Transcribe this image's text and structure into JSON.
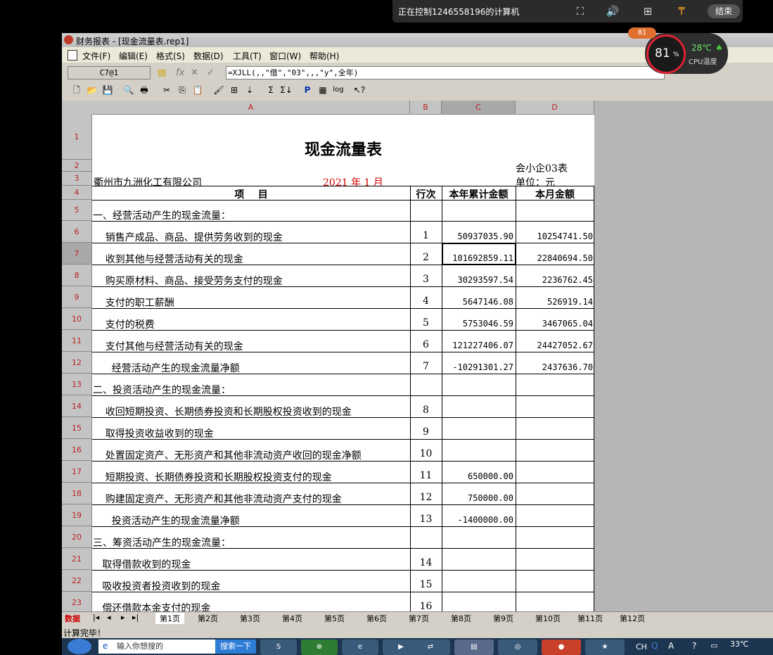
{
  "remote": {
    "title": "正在控制1246558196的计算机",
    "end_label": "结束"
  },
  "window": {
    "title": "财务报表 - [现金流量表.rep1]"
  },
  "menu": [
    "文件(F)",
    "编辑(E)",
    "格式(S)",
    "数据(D)",
    "工具(T)",
    "窗口(W)",
    "帮助(H)"
  ],
  "formula_bar": {
    "cell_ref": "C7@1",
    "formula": "=XJLL(,,\"借\",\"03\",,,\"y\",全年)"
  },
  "columns": [
    "A",
    "B",
    "C",
    "D"
  ],
  "report": {
    "title": "现金流量表",
    "form_no": "会小企03表",
    "company": "衢州市九洲化工有限公司",
    "period": "2021 年  1 月",
    "unit": "单位：元",
    "headers": [
      "项    目",
      "行次",
      "本年累计金额",
      "本月金额"
    ]
  },
  "rows": [
    {
      "row": "5",
      "item": "一、经营活动产生的现金流量：",
      "line": "",
      "ytd": "",
      "month": ""
    },
    {
      "row": "6",
      "item": "    销售产成品、商品、提供劳务收到的现金",
      "line": "1",
      "ytd": "50937035.90",
      "month": "10254741.50"
    },
    {
      "row": "7",
      "item": "    收到其他与经营活动有关的现金",
      "line": "2",
      "ytd": "101692859.11",
      "month": "22840694.50"
    },
    {
      "row": "8",
      "item": "    购买原材料、商品、接受劳务支付的现金",
      "line": "3",
      "ytd": "30293597.54",
      "month": "2236762.45"
    },
    {
      "row": "9",
      "item": "    支付的职工薪酬",
      "line": "4",
      "ytd": "5647146.08",
      "month": "526919.14"
    },
    {
      "row": "10",
      "item": "    支付的税费",
      "line": "5",
      "ytd": "5753046.59",
      "month": "3467065.04"
    },
    {
      "row": "11",
      "item": "    支付其他与经营活动有关的现金",
      "line": "6",
      "ytd": "121227406.07",
      "month": "24427052.67"
    },
    {
      "row": "12",
      "item": "      经营活动产生的现金流量净额",
      "line": "7",
      "ytd": "-10291301.27",
      "month": "2437636.70"
    },
    {
      "row": "13",
      "item": "二、投资活动产生的现金流量：",
      "line": "",
      "ytd": "",
      "month": ""
    },
    {
      "row": "14",
      "item": "    收回短期投资、长期债券投资和长期股权投资收到的现金",
      "line": "8",
      "ytd": "",
      "month": ""
    },
    {
      "row": "15",
      "item": "    取得投资收益收到的现金",
      "line": "9",
      "ytd": "",
      "month": ""
    },
    {
      "row": "16",
      "item": "    处置固定资产、无形资产和其他非流动资产收回的现金净额",
      "line": "10",
      "ytd": "",
      "month": ""
    },
    {
      "row": "17",
      "item": "    短期投资、长期债券投资和长期股权投资支付的现金",
      "line": "11",
      "ytd": "650000.00",
      "month": ""
    },
    {
      "row": "18",
      "item": "    购建固定资产、无形资产和其他非流动资产支付的现金",
      "line": "12",
      "ytd": "750000.00",
      "month": ""
    },
    {
      "row": "19",
      "item": "      投资活动产生的现金流量净额",
      "line": "13",
      "ytd": "-1400000.00",
      "month": ""
    },
    {
      "row": "20",
      "item": "三、筹资活动产生的现金流量：",
      "line": "",
      "ytd": "",
      "month": ""
    },
    {
      "row": "21",
      "item": "   取得借款收到的现金",
      "line": "14",
      "ytd": "",
      "month": ""
    },
    {
      "row": "22",
      "item": "   吸收投资者投资收到的现金",
      "line": "15",
      "ytd": "",
      "month": ""
    },
    {
      "row": "23",
      "item": "   偿还借款本金支付的现金",
      "line": "16",
      "ytd": "",
      "month": ""
    }
  ],
  "tabs": {
    "mode": "数据",
    "sheets": [
      "第1页",
      "第2页",
      "第3页",
      "第4页",
      "第5页",
      "第6页",
      "第7页",
      "第8页",
      "第9页",
      "第10页",
      "第11页",
      "第12页"
    ]
  },
  "status": "计算完毕！",
  "cpu": {
    "usage": "81",
    "usage_unit": "%",
    "temp": "28℃",
    "label": "CPU温度",
    "badge": "81"
  },
  "taskbar": {
    "search_placeholder": "输入你想搜的",
    "search_button": "搜索一下",
    "lang": "CH",
    "clock_temp": "33℃"
  }
}
